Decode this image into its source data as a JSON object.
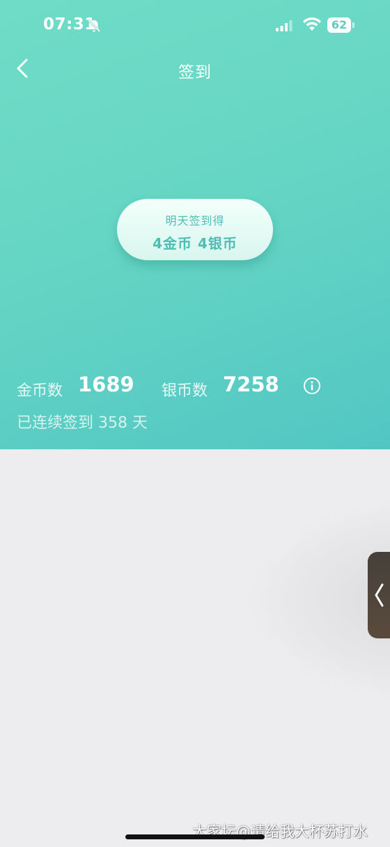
{
  "status_bar": {
    "time": "07:31",
    "battery_level": "62"
  },
  "nav": {
    "title": "签到"
  },
  "reward": {
    "line1": "明天签到得",
    "line2": "4金币 4银币"
  },
  "stats": {
    "gold_label": "金币数",
    "gold_value": "1689",
    "silver_label": "银币数",
    "silver_value": "7258",
    "streak_text": "已连续签到 358 天"
  },
  "watermark": "大家坛@请给我大杯苏打水",
  "colors": {
    "header_teal": "#66d6c4",
    "accent_text": "#4ebdb3",
    "background": "#ededef"
  },
  "icons": {
    "back": "chevron-left-icon",
    "info": "info-icon",
    "side_handle": "chevron-left-icon"
  }
}
